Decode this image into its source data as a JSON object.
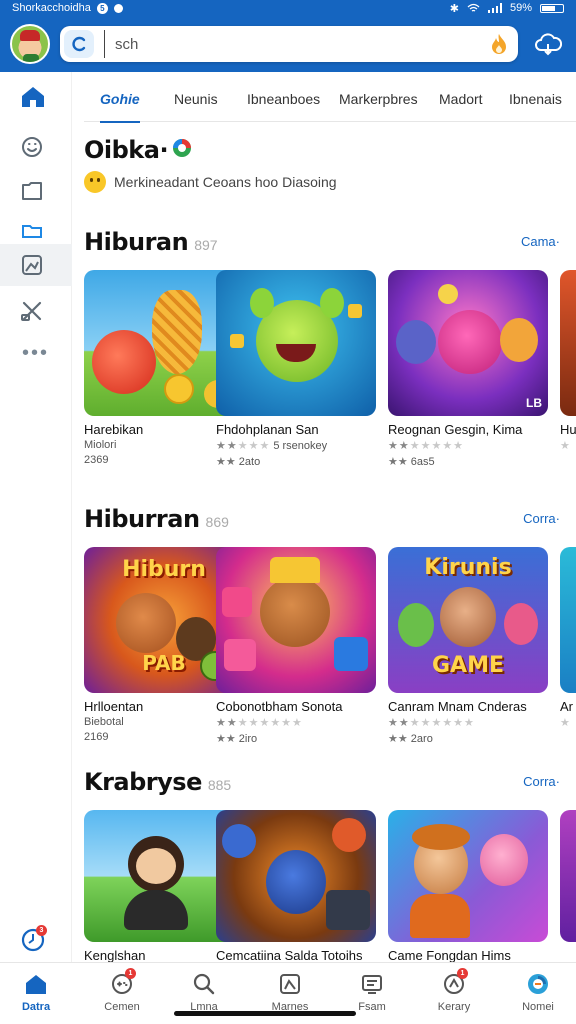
{
  "status_bar": {
    "left_text": "Shorkacchoidha",
    "left_badge": "5",
    "battery_text": "59%"
  },
  "search": {
    "placeholder": "sch",
    "value": ""
  },
  "tabs": [
    {
      "label": "Gohie",
      "active": true
    },
    {
      "label": "Neunis",
      "active": false
    },
    {
      "label": "Ibneanboes",
      "active": false
    },
    {
      "label": "Markerpbres",
      "active": false
    },
    {
      "label": "Madort",
      "active": false
    },
    {
      "label": "Ibnenais",
      "active": false
    }
  ],
  "featured": {
    "title": "Oibka·",
    "subtitle": "Merkineadant Ceoans hoo Diasoing"
  },
  "sections": [
    {
      "title": "Hiburan",
      "count": "897",
      "link": "Cama·",
      "cards": [
        {
          "name": "Harebikan",
          "meta": "Miolori",
          "rating": "2369",
          "colors": [
            "#3fa8e6",
            "#8ed14a"
          ]
        },
        {
          "name": "Fhdohplanan San",
          "meta": "5 rsenokey",
          "rating": "2ato",
          "colors": [
            "#1b9bd8",
            "#0f5fa8"
          ]
        },
        {
          "name": "Reognan Gesgin, Kima",
          "meta": "",
          "rating": "6as5",
          "colors": [
            "#7b2fbf",
            "#e0458f"
          ],
          "corner": "LB"
        },
        {
          "name": "Hu",
          "meta": "",
          "rating": "",
          "colors": [
            "#e0562b",
            "#7a2a10"
          ]
        }
      ]
    },
    {
      "title": "Hiburran",
      "count": "869",
      "link": "Corra·",
      "cards": [
        {
          "name": "Hrlloentan",
          "meta": "Biebotal",
          "rating": "2169",
          "colors": [
            "#d8581c",
            "#6d1f9a"
          ],
          "art_text": "Hiburn",
          "art_text2": "PAB"
        },
        {
          "name": "Cobonotbham Sonota",
          "meta": "",
          "rating": "2iro",
          "colors": [
            "#d42c8c",
            "#f4a73b"
          ]
        },
        {
          "name": "Canram Mnam Cnderas",
          "meta": "",
          "rating": "2aro",
          "colors": [
            "#3a6fd6",
            "#8a3fc4"
          ],
          "art_text": "Kirunis",
          "art_text2": "GAME"
        },
        {
          "name": "Ar",
          "meta": "",
          "rating": "",
          "colors": [
            "#2bbbd8",
            "#1a7fc4"
          ]
        }
      ]
    },
    {
      "title": "Krabryse",
      "count": "885",
      "link": "Corra·",
      "cards": [
        {
          "name": "Kenglshan",
          "meta": "",
          "rating": "",
          "colors": [
            "#57b7f0",
            "#7ed35a"
          ]
        },
        {
          "name": "Cemcatiina Salda Totoihs",
          "meta": "",
          "rating": "",
          "colors": [
            "#f08b2a",
            "#2a3f8f"
          ]
        },
        {
          "name": "Came Fongdan Hims",
          "meta": "",
          "rating": "",
          "colors": [
            "#2ab0e8",
            "#c94bd6"
          ]
        },
        {
          "name": "",
          "meta": "",
          "rating": "",
          "colors": [
            "#b040c0",
            "#6020a0"
          ]
        }
      ]
    }
  ],
  "bottom_nav": [
    {
      "label": "Datra",
      "icon": "home-icon",
      "active": true,
      "badge": ""
    },
    {
      "label": "Cemen",
      "icon": "gamepad-icon",
      "active": false,
      "badge": "1"
    },
    {
      "label": "Lmna",
      "icon": "search-icon",
      "active": false,
      "badge": ""
    },
    {
      "label": "Marnes",
      "icon": "image-icon",
      "active": false,
      "badge": ""
    },
    {
      "label": "Fsam",
      "icon": "store-icon",
      "active": false,
      "badge": ""
    },
    {
      "label": "Kerary",
      "icon": "library-icon",
      "active": false,
      "badge": "1"
    },
    {
      "label": "Nomei",
      "icon": "profile-icon",
      "active": false,
      "badge": ""
    }
  ],
  "rail_badge": "3",
  "colors": {
    "primary": "#1565c0",
    "header_bg": "#1565c0",
    "link": "#1565c0"
  }
}
